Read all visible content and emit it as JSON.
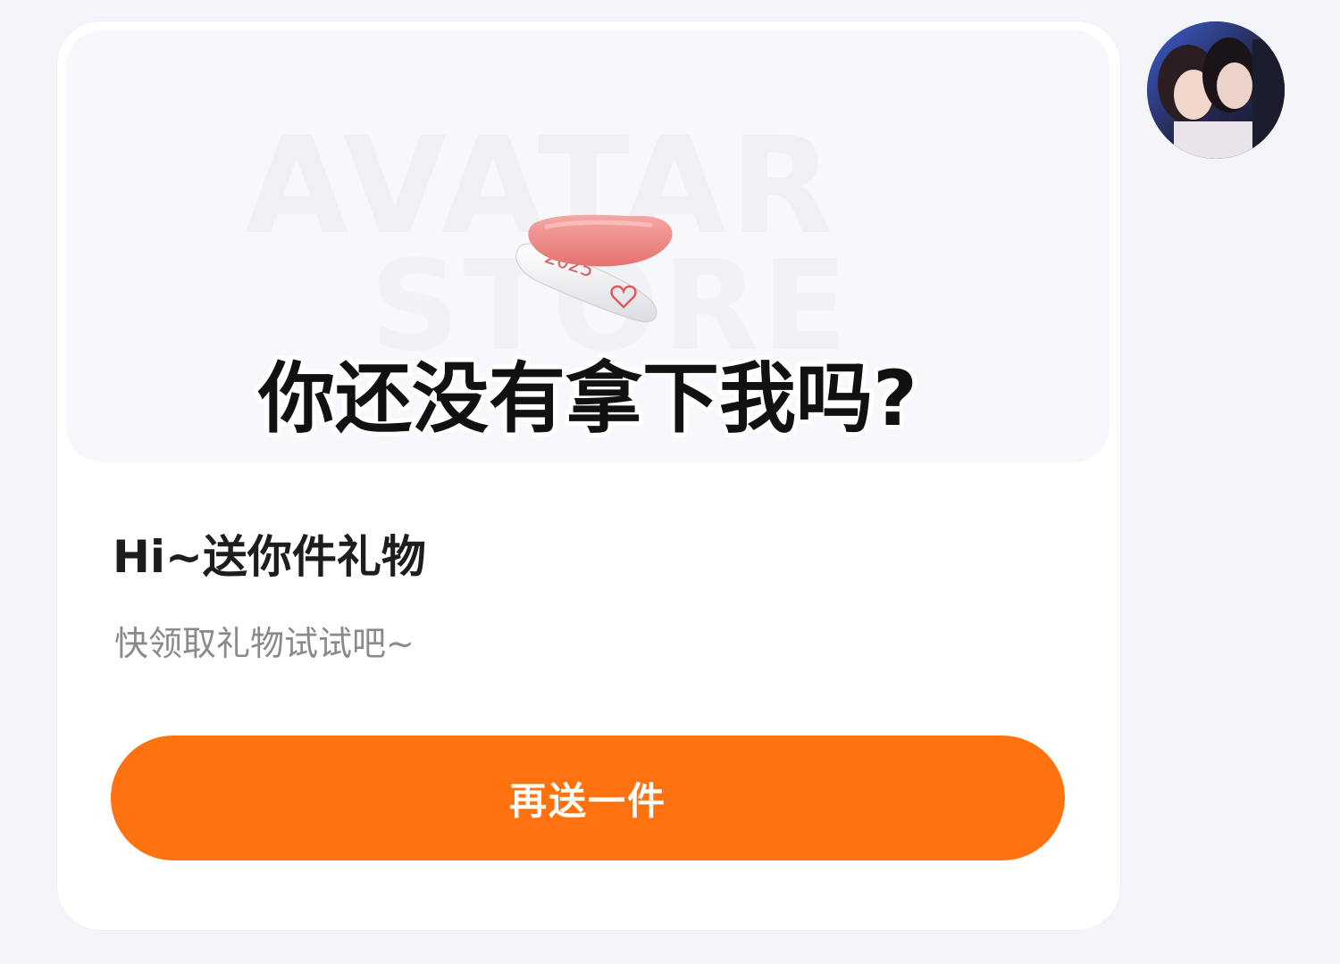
{
  "gift_card": {
    "watermark_line1": "AVATAR",
    "watermark_line2": "STORE",
    "clip_text": "2025",
    "caption": "你还没有拿下我吗?",
    "title": "Hi~送你件礼物",
    "subtitle": "快领取礼物试试吧~",
    "button_label": "再送一件"
  },
  "colors": {
    "accent": "#ff7210",
    "clip_pink": "#f08a8a",
    "clip_white": "#f4f4f6"
  },
  "icons": {
    "product": "hair-clip-image",
    "avatar": "user-avatar-photo"
  }
}
